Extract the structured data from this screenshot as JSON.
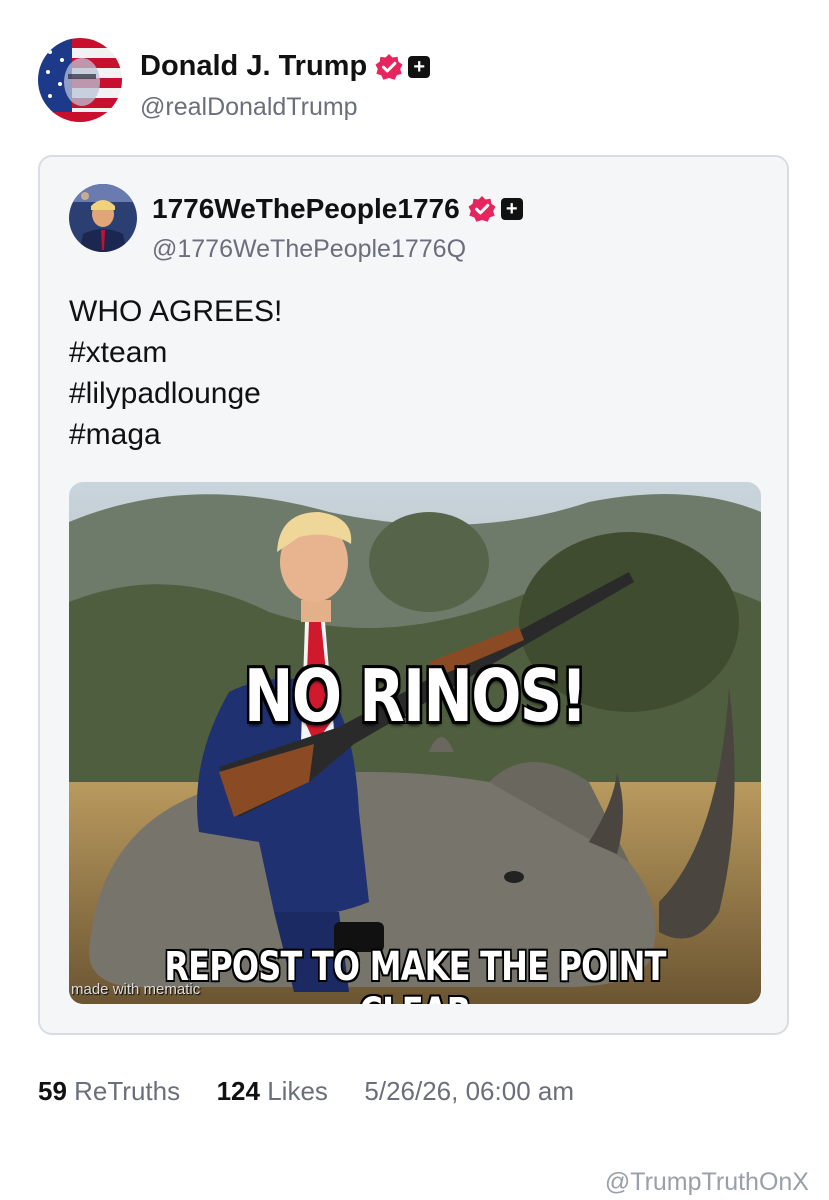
{
  "author": {
    "display_name": "Donald J. Trump",
    "handle": "@realDonaldTrump",
    "avatar_icon": "avatar-flag-portrait"
  },
  "quoted_post": {
    "display_name": "1776WeThePeople1776",
    "handle": "@1776WeThePeople1776Q",
    "text_lines": [
      "WHO AGREES!",
      "#xteam",
      "#lilypadlounge",
      "#maga"
    ],
    "image": {
      "top_caption": "NO RINOS!",
      "bottom_caption": "REPOST TO MAKE THE POINT CLEAR",
      "watermark": "made with mematic"
    }
  },
  "stats": {
    "retruths_count": "59",
    "retruths_label": "ReTruths",
    "likes_count": "124",
    "likes_label": "Likes",
    "timestamp": "5/26/26, 06:00 am"
  },
  "credit": "@TrumpTruthOnX",
  "colors": {
    "verified_badge": "#e6245e",
    "handle_gray": "#6b6f7b",
    "card_border": "#d9dde3",
    "card_bg": "#f5f6f8"
  }
}
